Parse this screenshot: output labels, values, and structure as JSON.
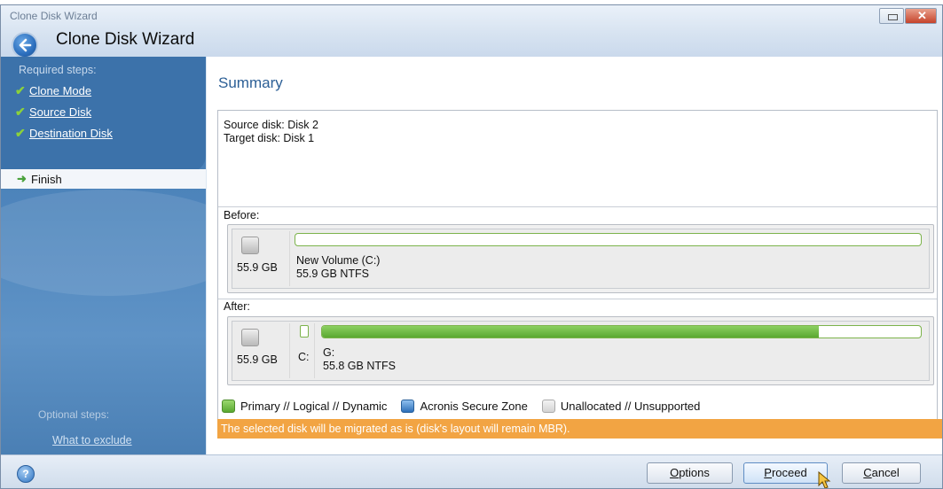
{
  "window": {
    "app_title": "Clone Disk Wizard",
    "heading": "Clone Disk Wizard"
  },
  "sidebar": {
    "required_label": "Required steps:",
    "steps": [
      {
        "label": "Clone Mode",
        "done": true
      },
      {
        "label": "Source Disk",
        "done": true
      },
      {
        "label": "Destination Disk",
        "done": true
      }
    ],
    "current_step": "Finish",
    "optional_label": "Optional steps:",
    "optional_link": "What to exclude"
  },
  "summary": {
    "title": "Summary",
    "source_line": "Source disk: Disk 2",
    "target_line": "Target disk: Disk 1",
    "before_label": "Before:",
    "after_label": "After:",
    "before_disk": {
      "size": "55.9 GB",
      "volume_name": "New Volume (C:)",
      "volume_fs": "55.9 GB  NTFS",
      "used_fraction": 0.0
    },
    "after_disk": {
      "size": "55.9 GB",
      "small_partition_label": "C:",
      "volume_name": "G:",
      "volume_fs": "55.8 GB  NTFS",
      "used_fraction": 0.83
    }
  },
  "legend": {
    "primary": "Primary // Logical // Dynamic",
    "acronis": "Acronis Secure Zone",
    "unallocated": "Unallocated // Unsupported"
  },
  "warning": "The selected disk will be migrated as is (disk's layout will remain MBR).",
  "footer": {
    "options_pre": "",
    "options_key": "O",
    "options_rest": "ptions",
    "proceed_key": "P",
    "proceed_rest": "roceed",
    "cancel_key": "C",
    "cancel_rest": "ancel"
  },
  "colors": {
    "accent": "#2c5f96",
    "partition_green": "#5aa831",
    "warning_orange": "#f2a443"
  }
}
